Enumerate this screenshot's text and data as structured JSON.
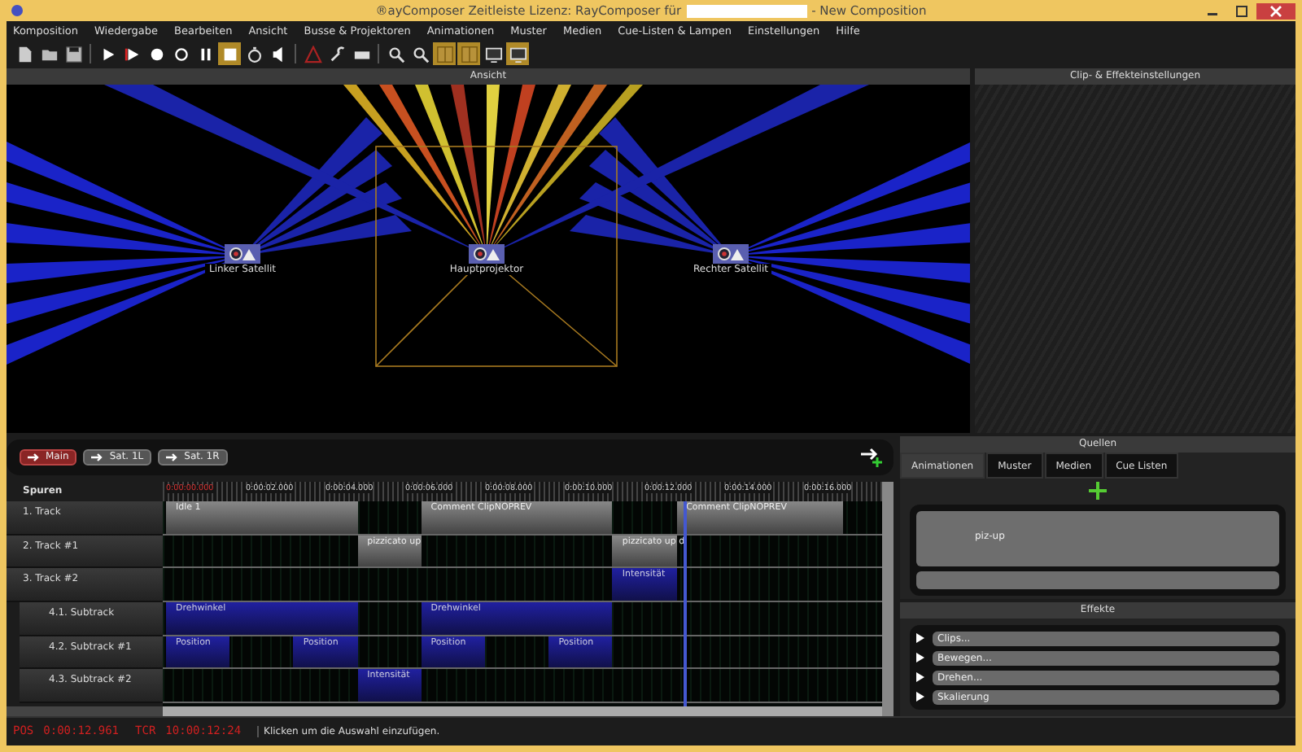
{
  "window": {
    "title": "®ayComposer Zeitleiste Lizenz: RayComposer für",
    "title_suffix": "- New Composition"
  },
  "menu": [
    "Komposition",
    "Wiedergabe",
    "Bearbeiten",
    "Ansicht",
    "Busse & Projektoren",
    "Animationen",
    "Muster",
    "Medien",
    "Cue-Listen & Lampen",
    "Einstellungen",
    "Hilfe"
  ],
  "toolbar": [
    {
      "kind": "new",
      "active": false
    },
    {
      "kind": "open",
      "active": false
    },
    {
      "kind": "save",
      "active": false
    },
    {
      "kind": "sep"
    },
    {
      "kind": "play",
      "active": false
    },
    {
      "kind": "play-marked",
      "active": false
    },
    {
      "kind": "record",
      "active": false
    },
    {
      "kind": "loop",
      "active": false
    },
    {
      "kind": "pause",
      "active": false
    },
    {
      "kind": "stop",
      "active": true
    },
    {
      "kind": "timer",
      "active": false
    },
    {
      "kind": "speaker",
      "active": false
    },
    {
      "kind": "sep"
    },
    {
      "kind": "warning",
      "active": false
    },
    {
      "kind": "wrench",
      "active": false
    },
    {
      "kind": "device",
      "active": false
    },
    {
      "kind": "sep"
    },
    {
      "kind": "zoom-in",
      "active": false
    },
    {
      "kind": "zoom-out",
      "active": false
    },
    {
      "kind": "grid",
      "active": true
    },
    {
      "kind": "grid",
      "active": true
    },
    {
      "kind": "display",
      "active": false
    },
    {
      "kind": "display",
      "active": true
    }
  ],
  "view_panel": {
    "title": "Ansicht",
    "projectors": [
      {
        "name": "Linker Satellit"
      },
      {
        "name": "Hauptprojektor"
      },
      {
        "name": "Rechter Satellit"
      }
    ]
  },
  "clip_panel": {
    "title": "Clip- & Effekteinstellungen"
  },
  "timeline": {
    "buses": [
      {
        "label": "Main",
        "selected": true
      },
      {
        "label": "Sat. 1L",
        "selected": false
      },
      {
        "label": "Sat. 1R",
        "selected": false
      }
    ],
    "tracks_header": "Spuren",
    "ruler": [
      "0:00:00.000",
      "0:00:02.000",
      "0:00:04.000",
      "0:00:06.000",
      "0:00:08.000",
      "0:00:10.000",
      "0:00:12.000",
      "0:00:14.000",
      "0:00:16.000"
    ],
    "tracks": [
      {
        "name": "1. Track",
        "kind": "track",
        "clips": [
          {
            "label": "Idle 1",
            "kind": "comment"
          },
          {
            "label": "Comment ClipNOPREV",
            "kind": "comment"
          },
          {
            "label": "Comment ClipNOPREV",
            "kind": "comment"
          }
        ]
      },
      {
        "name": "2. Track #1",
        "kind": "track",
        "clips": [
          {
            "label": "pizzicato up",
            "kind": "comment"
          },
          {
            "label": "pizzicato up d",
            "kind": "comment"
          }
        ]
      },
      {
        "name": "3. Track #2",
        "kind": "track",
        "clips": [
          {
            "label": "Intensität",
            "kind": "animation"
          }
        ]
      },
      {
        "name": "4.1. Subtrack",
        "kind": "subtrack",
        "clips": [
          {
            "label": "Drehwinkel",
            "kind": "animation"
          },
          {
            "label": "Drehwinkel",
            "kind": "animation"
          }
        ]
      },
      {
        "name": "4.2. Subtrack #1",
        "kind": "subtrack",
        "clips": [
          {
            "label": "Position",
            "kind": "animation"
          },
          {
            "label": "Position",
            "kind": "animation"
          },
          {
            "label": "Position",
            "kind": "animation"
          },
          {
            "label": "Position",
            "kind": "animation"
          }
        ]
      },
      {
        "name": "4.3. Subtrack #2",
        "kind": "subtrack",
        "clips": [
          {
            "label": "Intensität",
            "kind": "animation"
          }
        ]
      }
    ]
  },
  "sources": {
    "title": "Quellen",
    "tabs": [
      {
        "label": "Animationen",
        "selected": true
      },
      {
        "label": "Muster",
        "selected": false
      },
      {
        "label": "Medien",
        "selected": false
      },
      {
        "label": "Cue Listen",
        "selected": false
      }
    ],
    "items": [
      "piz-up"
    ]
  },
  "effects": {
    "title": "Effekte",
    "items": [
      {
        "label": "Clips...",
        "expanded": false
      },
      {
        "label": "Bewegen...",
        "expanded": false
      },
      {
        "label": "Drehen...",
        "expanded": false
      },
      {
        "label": "Skalierung",
        "expanded": false
      }
    ]
  },
  "status": {
    "pos_label": "POS",
    "pos": "0:00:12.961",
    "tcr_label": "TCR",
    "tcr": "10:00:12:24",
    "message": "Klicken um die Auswahl einzufügen."
  }
}
